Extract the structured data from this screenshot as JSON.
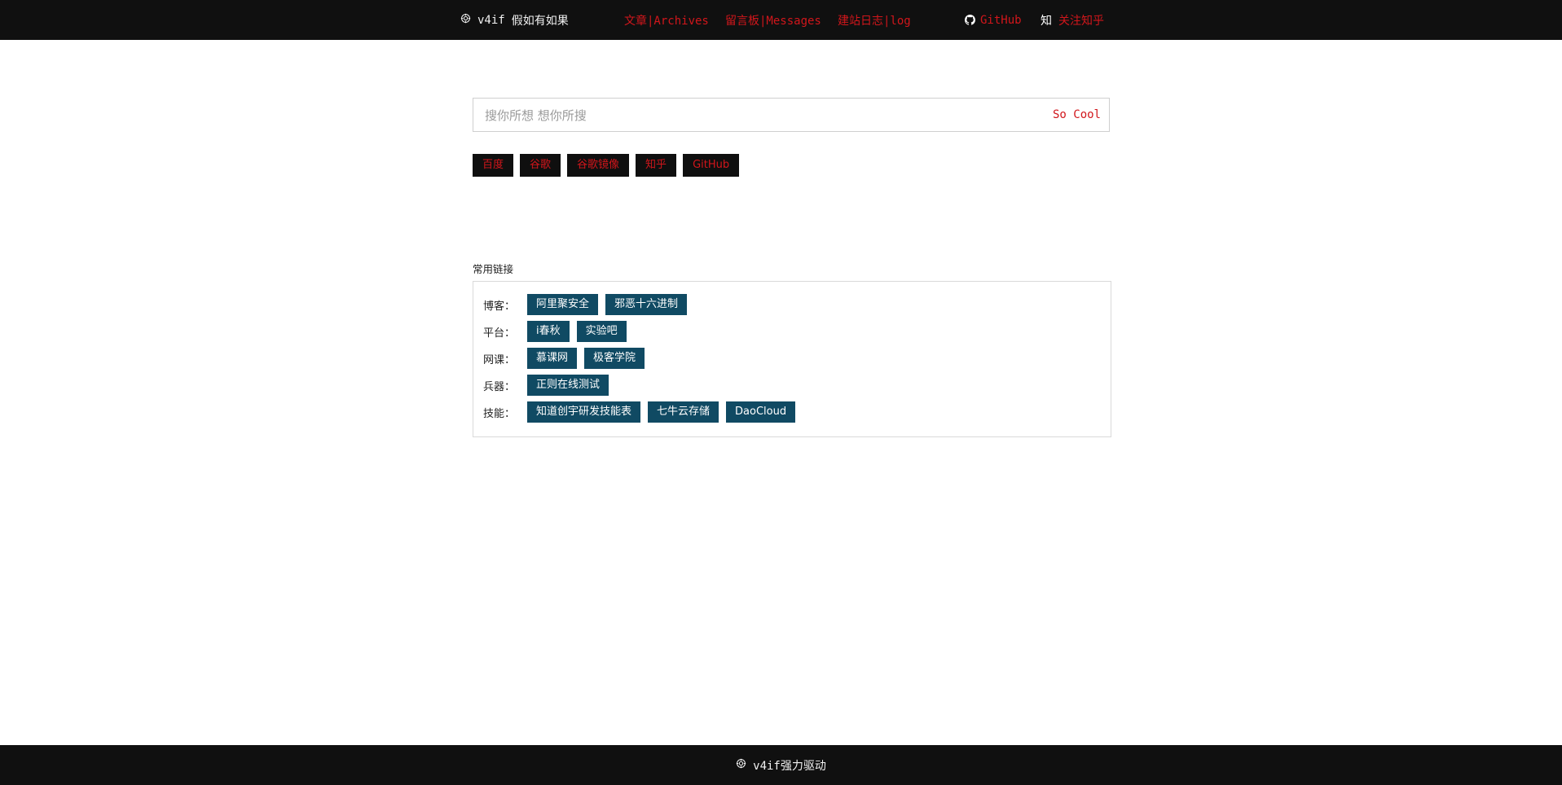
{
  "header": {
    "brand": {
      "name": "v4if",
      "tagline": "假如有如果",
      "icon": "settings-cog-icon"
    },
    "nav": {
      "articles": "文章|Archives",
      "messages": "留言板|Messages",
      "log": "建站日志|log",
      "github": "GitHub",
      "github_icon": "github-icon",
      "zhihu_glyph": "知",
      "zhihu": "关注知乎"
    }
  },
  "search": {
    "placeholder": "搜你所想 想你所搜",
    "button": "So Cool",
    "engines": [
      "百度",
      "谷歌",
      "谷歌镜像",
      "知乎",
      "GitHub"
    ]
  },
  "links": {
    "title": "常用链接",
    "rows": [
      {
        "label": "博客：",
        "items": [
          "阿里聚安全",
          "邪恶十六进制"
        ]
      },
      {
        "label": "平台：",
        "items": [
          "i春秋",
          "实验吧"
        ]
      },
      {
        "label": "网课：",
        "items": [
          "慕课网",
          "极客学院"
        ]
      },
      {
        "label": "兵器：",
        "items": [
          "正则在线测试"
        ]
      },
      {
        "label": "技能：",
        "items": [
          "知道创宇研发技能表",
          "七牛云存储",
          "DaoCloud"
        ]
      }
    ]
  },
  "footer": {
    "text": "v4if强力驱动",
    "icon": "settings-cog-icon"
  },
  "colors": {
    "bar_bg": "#101010",
    "accent_red": "#d1161b",
    "chip_blue": "#104a63",
    "border": "#d9d9d9"
  }
}
